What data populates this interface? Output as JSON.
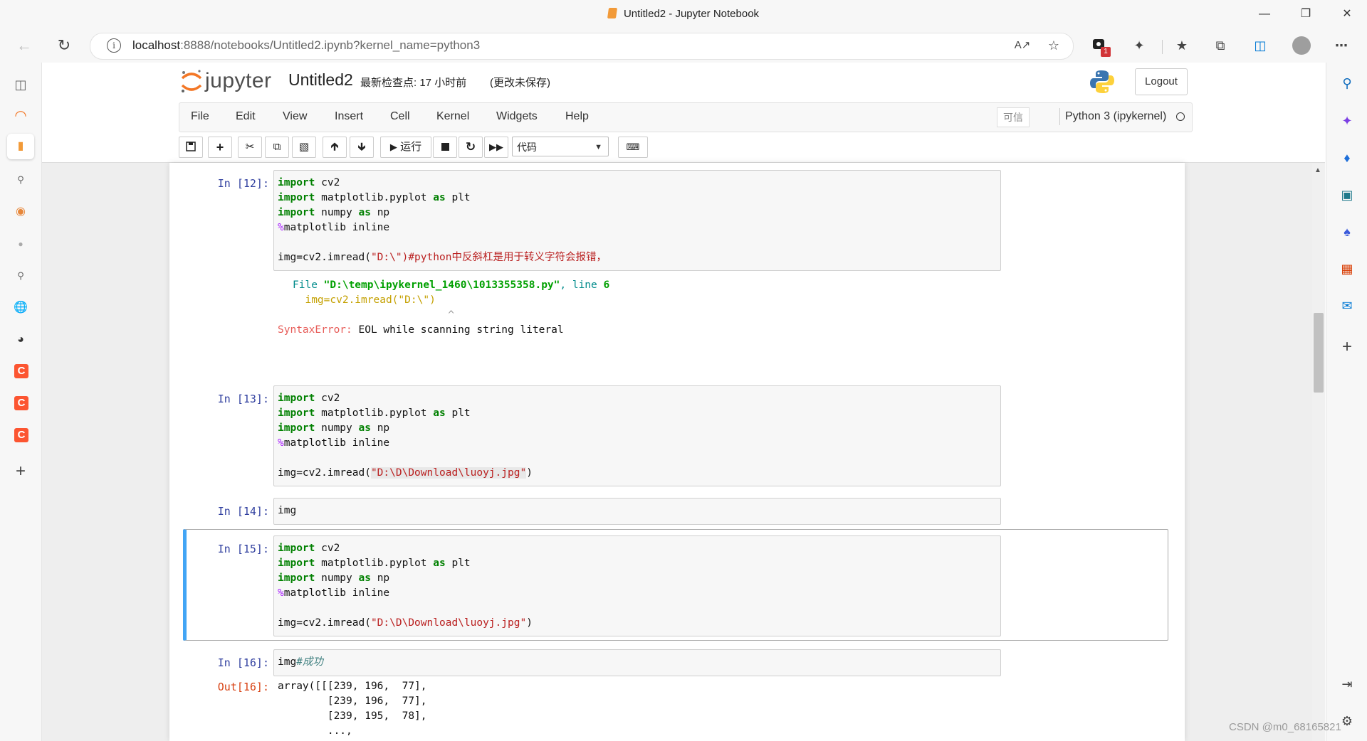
{
  "window": {
    "title": "Untitled2 - Jupyter Notebook",
    "minimize_icon": "minimize-icon",
    "restore_icon": "restore-icon",
    "close_icon": "close-icon"
  },
  "browser": {
    "url_host": "localhost",
    "url_rest": ":8888/notebooks/Untitled2.ipynb?kernel_name=python3",
    "extensions_badge": "1"
  },
  "jupyter": {
    "logo_text": "jupyter",
    "notebook_name": "Untitled2",
    "checkpoint": "最新检查点: 17 小时前",
    "unsaved": "(更改未保存)",
    "logout_label": "Logout",
    "menu": [
      "File",
      "Edit",
      "View",
      "Insert",
      "Cell",
      "Kernel",
      "Widgets",
      "Help"
    ],
    "trusted_label": "可信",
    "kernel_name": "Python 3 (ipykernel)",
    "run_label": "运行",
    "cell_type": "代码"
  },
  "cells": {
    "c12": {
      "prompt": "In  [12]:",
      "line1_kw": "import",
      "line1_rest": " cv2",
      "line2_kw": "import",
      "line2_mid": " matplotlib.pyplot ",
      "line2_kw2": "as",
      "line2_rest": " plt",
      "line3_kw": "import",
      "line3_mid": " numpy ",
      "line3_kw2": "as",
      "line3_rest": " np",
      "line4_mg": "%",
      "line4_rest": "matplotlib inline",
      "line6_pre": "img=cv2.imread(",
      "line6_str": "\"D:\\\")#python中反斜杠是用于转义字符会报错，",
      "err_file_kw": "File",
      "err_file_path": "\"D:\\temp\\ipykernel_1460\\1013355358.py\"",
      "err_line_kw": ", line",
      "err_line_no": "6",
      "err_code": "img=cv2.imread(\"D:\\\")",
      "err_caret": "^",
      "err_type": "SyntaxError:",
      "err_msg": " EOL while scanning string literal"
    },
    "c13": {
      "prompt": "In  [13]:",
      "line6_pre": "img=cv2.imread(",
      "line6_str": "\"D:\\D\\Download\\luoyj.jpg\"",
      "line6_post": ")"
    },
    "c14": {
      "prompt": "In  [14]:",
      "code": "img"
    },
    "c15": {
      "prompt": "In  [15]:",
      "line6_pre": "img=cv2.imread(",
      "line6_str": "\"D:\\D\\Download\\luoyj.jpg\"",
      "line6_post": ")"
    },
    "c16": {
      "prompt": "In  [16]:",
      "code": "img",
      "comment": "#成功",
      "out_prompt": "Out[16]:",
      "out_lines": [
        "array([[[239, 196,  77],",
        "        [239, 196,  77],",
        "        [239, 195,  78],",
        "        ...,"
      ]
    }
  },
  "watermark": "CSDN @m0_68165821"
}
